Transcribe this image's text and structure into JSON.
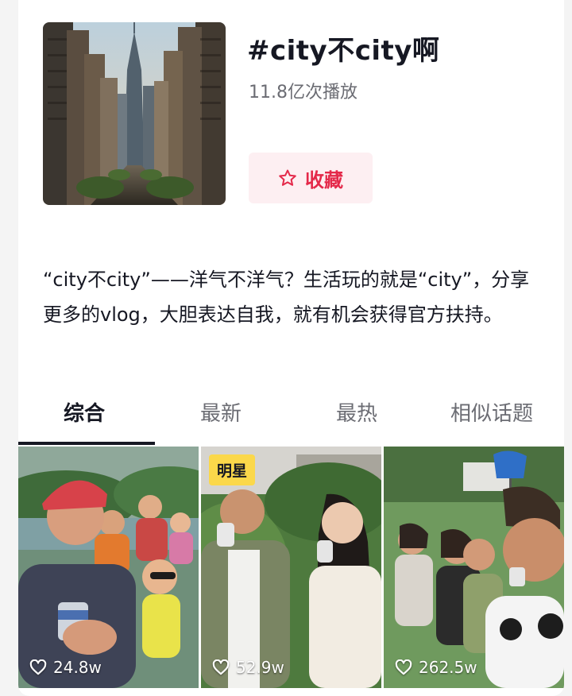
{
  "topic": {
    "title": "#city不city啊",
    "plays": "11.8亿次播放",
    "favorite_label": "收藏",
    "description": "“city不city”——洋气不洋气？生活玩的就是“city”，分享更多的vlog，大胆表达自我，就有机会获得官方扶持。"
  },
  "tabs": [
    {
      "label": "综合",
      "active": true
    },
    {
      "label": "最新",
      "active": false
    },
    {
      "label": "最热",
      "active": false
    },
    {
      "label": "相似话题",
      "active": false
    }
  ],
  "videos": [
    {
      "likes": "24.8w",
      "badge": ""
    },
    {
      "likes": "52.9w",
      "badge": "明星"
    },
    {
      "likes": "262.5w",
      "badge": ""
    }
  ],
  "colors": {
    "accent": "#e4294a",
    "accent_bg": "#fdeff2",
    "badge": "#fbd84a",
    "muted_text": "#6b6c73"
  },
  "icons": {
    "favorite": "star-outline-icon",
    "likes": "heart-outline-icon"
  }
}
